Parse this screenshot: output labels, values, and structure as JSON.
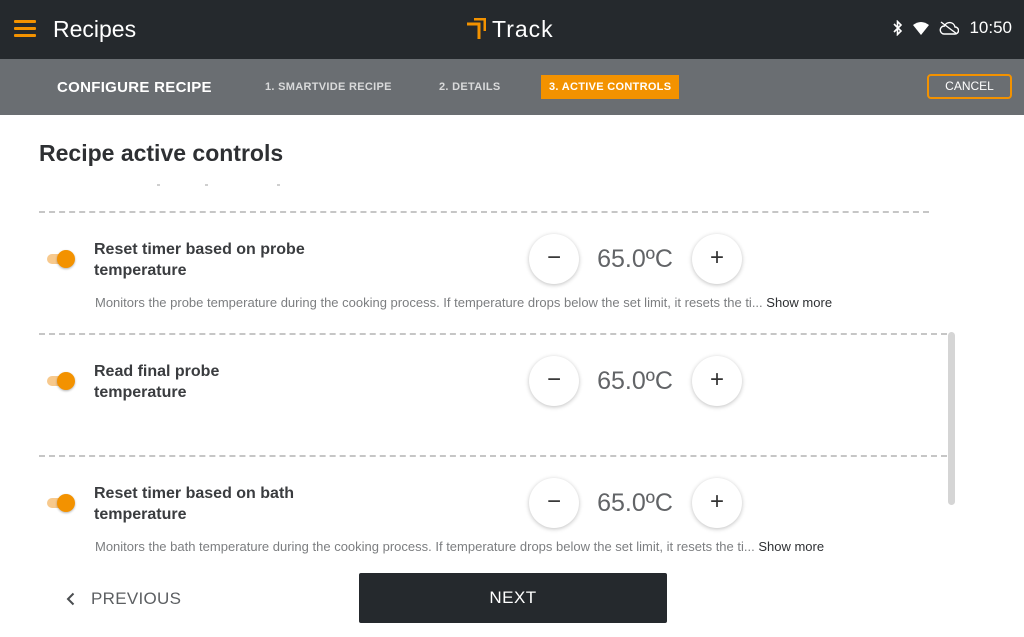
{
  "appbar": {
    "title": "Recipes",
    "brand": "Track",
    "time": "10:50",
    "icons": [
      "menu-icon",
      "bluetooth-icon",
      "wifi-icon",
      "cloud-off-icon"
    ]
  },
  "stepbar": {
    "title": "CONFIGURE RECIPE",
    "steps": [
      {
        "label": "1. SMARTVIDE RECIPE",
        "active": false
      },
      {
        "label": "2. DETAILS",
        "active": false
      },
      {
        "label": "3. ACTIVE CONTROLS",
        "active": true
      }
    ],
    "cancel_label": "CANCEL"
  },
  "content": {
    "heading": "Recipe active controls",
    "controls": [
      {
        "title": "Reset timer based on probe temperature",
        "enabled": true,
        "value": "65.0ºC",
        "description": "Monitors the probe temperature during the cooking process. If temperature drops below the set limit, it resets the ti...",
        "show_more": "Show more"
      },
      {
        "title": "Read final probe temperature",
        "enabled": true,
        "value": "65.0ºC",
        "description": "",
        "show_more": ""
      },
      {
        "title": "Reset timer based on bath temperature",
        "enabled": true,
        "value": "65.0ºC",
        "description": "Monitors the bath temperature during the cooking process. If temperature drops below the set limit, it resets the ti...",
        "show_more": "Show more"
      }
    ],
    "minus_symbol": "−",
    "plus_symbol": "+"
  },
  "footer": {
    "previous_label": "PREVIOUS",
    "next_label": "NEXT"
  },
  "colors": {
    "accent": "#f39200",
    "appbar": "#25292d",
    "stepbar": "#6a6e72"
  }
}
